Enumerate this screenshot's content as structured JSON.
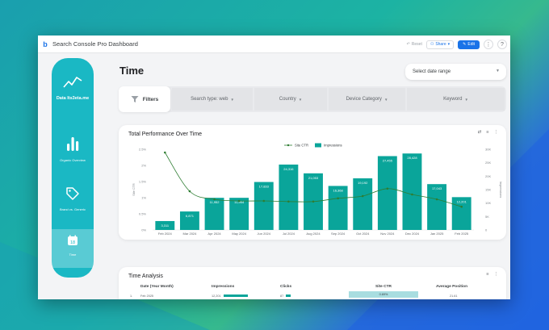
{
  "app": {
    "title": "Search Console Pro Dashboard",
    "reset_label": "Reset",
    "share_label": "Share",
    "edit_label": "Edit"
  },
  "sidebar": {
    "brand": "Data Its3eta.me",
    "items": [
      {
        "label": "Organic Overview",
        "icon": "trend-icon"
      },
      {
        "label": "Brand vs. Generic",
        "icon": "tag-icon"
      },
      {
        "label": "Time",
        "icon": "calendar-icon",
        "active": true
      }
    ]
  },
  "page": {
    "title": "Time",
    "date_range_placeholder": "Select date range"
  },
  "filters": {
    "label": "Filters",
    "dropdowns": [
      "Search type: web",
      "Country",
      "Device Category",
      "Keyword"
    ]
  },
  "chart_card": {
    "title": "Total Performance Over Time"
  },
  "chart_data": {
    "type": "bar",
    "title": "Total Performance Over Time",
    "categories": [
      "Feb 2024",
      "Mar 2024",
      "Apr 2024",
      "May 2024",
      "Jun 2024",
      "Jul 2024",
      "Aug 2024",
      "Sep 2024",
      "Oct 2024",
      "Nov 2024",
      "Dec 2024",
      "Jan 2025",
      "Feb 2025"
    ],
    "series": [
      {
        "name": "Impressions",
        "kind": "bar",
        "axis": "right",
        "color": "#0aa59a",
        "values": [
          3311,
          6871,
          11952,
          11954,
          17833,
          24316,
          21053,
          16368,
          19192,
          27455,
          28428,
          17043,
          12201
        ],
        "labels": [
          "3,311",
          "6,871",
          "11,952",
          "11,954",
          "17,833",
          "24,316",
          "21,053",
          "16,368",
          "19,192",
          "27,455",
          "28,428",
          "17,043",
          "12,201"
        ]
      },
      {
        "name": "Site CTR",
        "kind": "line",
        "axis": "left",
        "color": "#2e7d32",
        "values": [
          2.4,
          1.2,
          0.95,
          0.9,
          0.9,
          0.88,
          0.88,
          0.98,
          1.05,
          1.28,
          1.1,
          0.95,
          0.72
        ]
      }
    ],
    "y_left": {
      "ticks": [
        "0%",
        "0.5%",
        "1%",
        "1.5%",
        "2%",
        "2.5%"
      ],
      "label": "Site CTR",
      "range": [
        0,
        2.5
      ]
    },
    "y_right": {
      "ticks": [
        "0",
        "5K",
        "10K",
        "15K",
        "20K",
        "25K",
        "30K"
      ],
      "label": "Impressions",
      "range": [
        0,
        30000
      ]
    },
    "legend": [
      "Site CTR",
      "Impressions"
    ],
    "legend_position": "top-center",
    "grid": false
  },
  "table": {
    "title": "Time Analysis",
    "columns": [
      "Date (Year Month)",
      "Impressions",
      "Clicks",
      "Site CTR",
      "Average Position"
    ],
    "rows": [
      {
        "index": "1.",
        "date": "Feb 2025",
        "impressions": "12,201",
        "clicks": "87",
        "ctr": "0.69%",
        "position": "21.61",
        "impressions_fraction": 0.43
      }
    ]
  }
}
